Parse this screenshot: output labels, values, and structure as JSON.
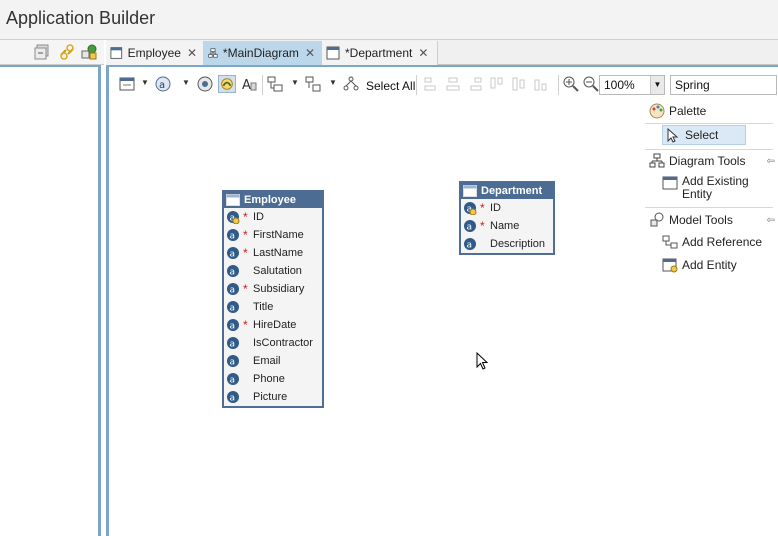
{
  "app": {
    "title": "Application Builder"
  },
  "tabs": [
    {
      "label": "Employee",
      "closable": true
    },
    {
      "label": "*MainDiagram",
      "closable": true,
      "active": true
    },
    {
      "label": "*Department",
      "closable": true
    }
  ],
  "toolbar": {
    "select_all_label": "Select All",
    "zoom_value": "100%",
    "theme_value": "Spring"
  },
  "palette": {
    "title": "Palette",
    "select": "Select",
    "diagram_tools": {
      "label": "Diagram Tools",
      "items": [
        "Add Existing Entity"
      ]
    },
    "model_tools": {
      "label": "Model Tools",
      "items": [
        "Add Reference",
        "Add Entity"
      ]
    }
  },
  "entities": {
    "employee": {
      "name": "Employee",
      "attributes": [
        {
          "name": "ID",
          "required": true,
          "key": true
        },
        {
          "name": "FirstName",
          "required": true
        },
        {
          "name": "LastName",
          "required": true
        },
        {
          "name": "Salutation",
          "required": false
        },
        {
          "name": "Subsidiary",
          "required": true
        },
        {
          "name": "Title",
          "required": false
        },
        {
          "name": "HireDate",
          "required": true
        },
        {
          "name": "IsContractor",
          "required": false
        },
        {
          "name": "Email",
          "required": false
        },
        {
          "name": "Phone",
          "required": false
        },
        {
          "name": "Picture",
          "required": false
        }
      ]
    },
    "department": {
      "name": "Department",
      "attributes": [
        {
          "name": "ID",
          "required": true,
          "key": true
        },
        {
          "name": "Name",
          "required": true
        },
        {
          "name": "Description",
          "required": false
        }
      ]
    }
  },
  "colors": {
    "entity_header": "#4c6c94",
    "active_tab": "#bcd7ea",
    "panel_border": "#7aa7c7"
  }
}
